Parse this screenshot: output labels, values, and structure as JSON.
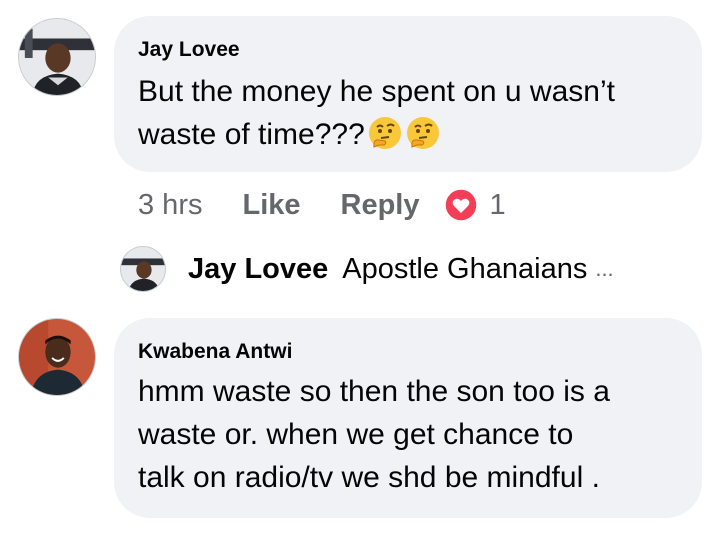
{
  "comments": [
    {
      "author": "Jay Lovee",
      "text_line1": "But the money he spent on u wasn’t",
      "text_line2": "waste of time???",
      "emojis": [
        "thinking-face-icon",
        "thinking-face-icon"
      ],
      "time": "3 hrs",
      "like_label": "Like",
      "reply_label": "Reply",
      "reaction_count": "1",
      "reaction_icon": "heart-icon"
    },
    {
      "author": "Kwabena Antwi",
      "text_line1": "hmm waste so then the son too is a",
      "text_line2": "waste or. when we get chance to",
      "text_line3": "talk on radio/tv we shd be mindful ."
    }
  ],
  "reply_preview": {
    "author": "Jay Lovee",
    "text": "Apostle Ghanaians",
    "ellipsis": "..."
  },
  "colors": {
    "bubble": "#f0f2f5",
    "text": "#050505",
    "meta": "#65676b",
    "heart": "#f33e58"
  }
}
